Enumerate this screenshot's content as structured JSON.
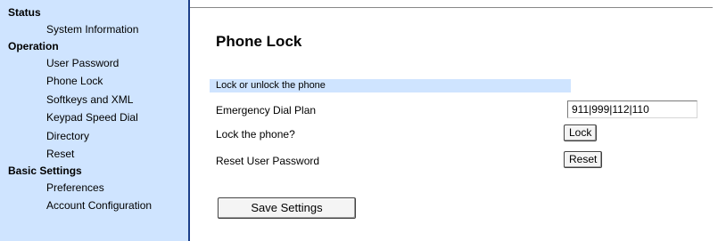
{
  "sidebar": {
    "sections": [
      {
        "title": "Status",
        "items": [
          "System Information"
        ]
      },
      {
        "title": "Operation",
        "items": [
          "User Password",
          "Phone Lock",
          "Softkeys and XML",
          "Keypad Speed Dial",
          "Directory",
          "Reset"
        ]
      },
      {
        "title": "Basic Settings",
        "items": [
          "Preferences",
          "Account Configuration"
        ]
      }
    ]
  },
  "main": {
    "title": "Phone Lock",
    "section_header": "Lock or unlock the phone",
    "rows": {
      "dial_plan_label": "Emergency Dial Plan",
      "dial_plan_value": "911|999|112|110",
      "lock_label": "Lock the phone?",
      "lock_button": "Lock",
      "reset_label": "Reset User Password",
      "reset_button": "Reset"
    },
    "save_button": "Save Settings"
  }
}
